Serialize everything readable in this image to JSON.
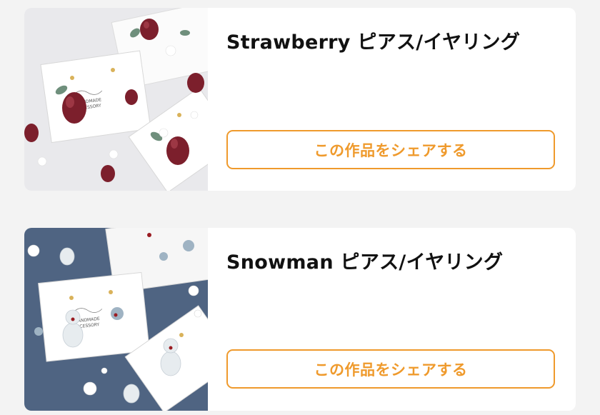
{
  "products": [
    {
      "title": "Strawberry ピアス/イヤリング",
      "image_alt": "Strawberry earrings on HANDMADE ACCESSORY cards",
      "share_label": "この作品をシェアする"
    },
    {
      "title": "Snowman ピアス/イヤリング",
      "image_alt": "Snowman earrings on HANDMADE ACCESSORY cards",
      "share_label": "この作品をシェアする"
    }
  ],
  "colors": {
    "accent": "#ef9a2c",
    "page_background": "#f3f3f3",
    "card_background": "#ffffff",
    "title_text": "#111111"
  }
}
